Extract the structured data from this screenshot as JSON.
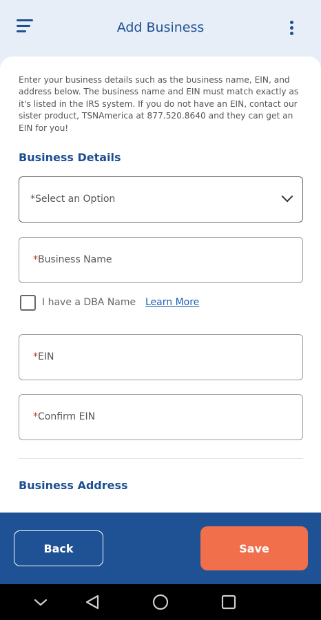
{
  "header": {
    "title": "Add Business",
    "menu_icon": "menu-icon",
    "more_icon": "more-vert-icon"
  },
  "intro_text": "Enter your business details such as the business name, EIN, and address below. The business name and EIN must match exactly as it's listed in the IRS system. If you do not have an EIN, contact our sister product, TSNAmerica at 877.520.8640 and they can get an EIN for you!",
  "business_details": {
    "title": "Business Details",
    "select_placeholder": "*Select an Option",
    "business_name_label": "Business Name",
    "dba_label": "I have a DBA Name",
    "learn_more": "Learn More",
    "ein_label": "EIN",
    "confirm_ein_label": "Confirm EIN",
    "required_marker": "*"
  },
  "business_address": {
    "title": "Business Address"
  },
  "footer": {
    "back_label": "Back",
    "save_label": "Save"
  },
  "colors": {
    "brand_blue": "#1d4f91",
    "footer_blue": "#1f5295",
    "save_orange": "#f26f4c",
    "required_red": "#c0392b"
  },
  "system_nav": {
    "icons": [
      "chevron-down-icon",
      "back-triangle-icon",
      "home-circle-icon",
      "recents-square-icon"
    ]
  }
}
